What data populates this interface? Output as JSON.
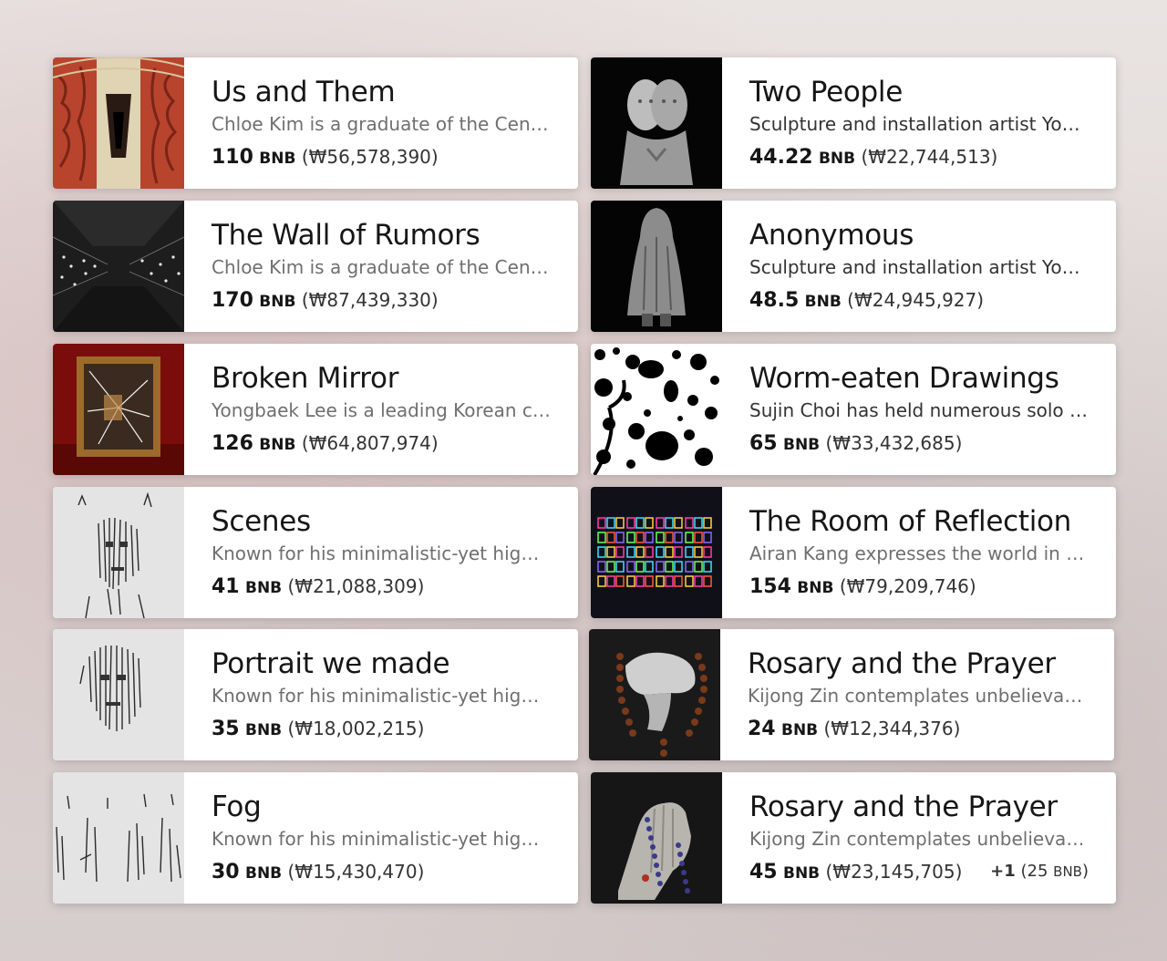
{
  "cards": [
    {
      "title": "Us and Them",
      "desc": "Chloe Kim is a graduate of the Central...",
      "amount": "110",
      "unit": "BNB",
      "krw": "(₩56,578,390)",
      "thumb": "tunnel-red-artwork"
    },
    {
      "title": "Two People",
      "desc": "Sculpture and installation artist Yongj...",
      "amount": "44.22",
      "unit": "BNB",
      "krw": "(₩22,744,513)",
      "thumb": "two-heads-sculpture"
    },
    {
      "title": "The Wall of Rumors",
      "desc": "Chloe Kim is a graduate of the Central...",
      "amount": "170",
      "unit": "BNB",
      "krw": "(₩87,439,330)",
      "thumb": "dark-lights-corridor"
    },
    {
      "title": "Anonymous",
      "desc": "Sculpture and installation artist Yongj...",
      "amount": "48.5",
      "unit": "BNB",
      "krw": "(₩24,945,927)",
      "thumb": "draped-figure-sculpture"
    },
    {
      "title": "Broken Mirror",
      "desc": "Yongbaek Lee is a leading Korean con...",
      "amount": "126",
      "unit": "BNB",
      "krw": "(₩64,807,974)",
      "thumb": "framed-broken-mirror"
    },
    {
      "title": "Worm-eaten Drawings",
      "desc": "Sujin Choi has held numerous solo an...",
      "amount": "65",
      "unit": "BNB",
      "krw": "(₩33,432,685)",
      "thumb": "black-ink-drawing"
    },
    {
      "title": "Scenes",
      "desc": "Known for his minimalistic-yet highly...",
      "amount": "41",
      "unit": "BNB",
      "krw": "(₩21,088,309)",
      "thumb": "line-face-artwork"
    },
    {
      "title": "The Room of Reflection",
      "desc": "Airan Kang expresses the world in bo...",
      "amount": "154",
      "unit": "BNB",
      "krw": "(₩79,209,746)",
      "thumb": "neon-books-installation"
    },
    {
      "title": "Portrait we made",
      "desc": "Known for his minimalistic-yet highly...",
      "amount": "35",
      "unit": "BNB",
      "krw": "(₩18,002,215)",
      "thumb": "line-portrait-artwork"
    },
    {
      "title": "Rosary and the Prayer",
      "desc": "Kijong Zin contemplates unbelievable...",
      "amount": "24",
      "unit": "BNB",
      "krw": "(₩12,344,376)",
      "thumb": "hand-rosary-sculpture"
    },
    {
      "title": "Fog",
      "desc": "Known for his minimalistic-yet highly...",
      "amount": "30",
      "unit": "BNB",
      "krw": "(₩15,430,470)",
      "thumb": "line-figures-artwork"
    },
    {
      "title": "Rosary and the Prayer",
      "desc": "Kijong Zin contemplates unbelievable...",
      "amount": "45",
      "unit": "BNB",
      "krw": "(₩23,145,705)",
      "thumb": "praying-hands-rosary",
      "extra": {
        "count": "+1",
        "open": "(25",
        "unit": "BNB",
        "close": ")"
      }
    }
  ]
}
